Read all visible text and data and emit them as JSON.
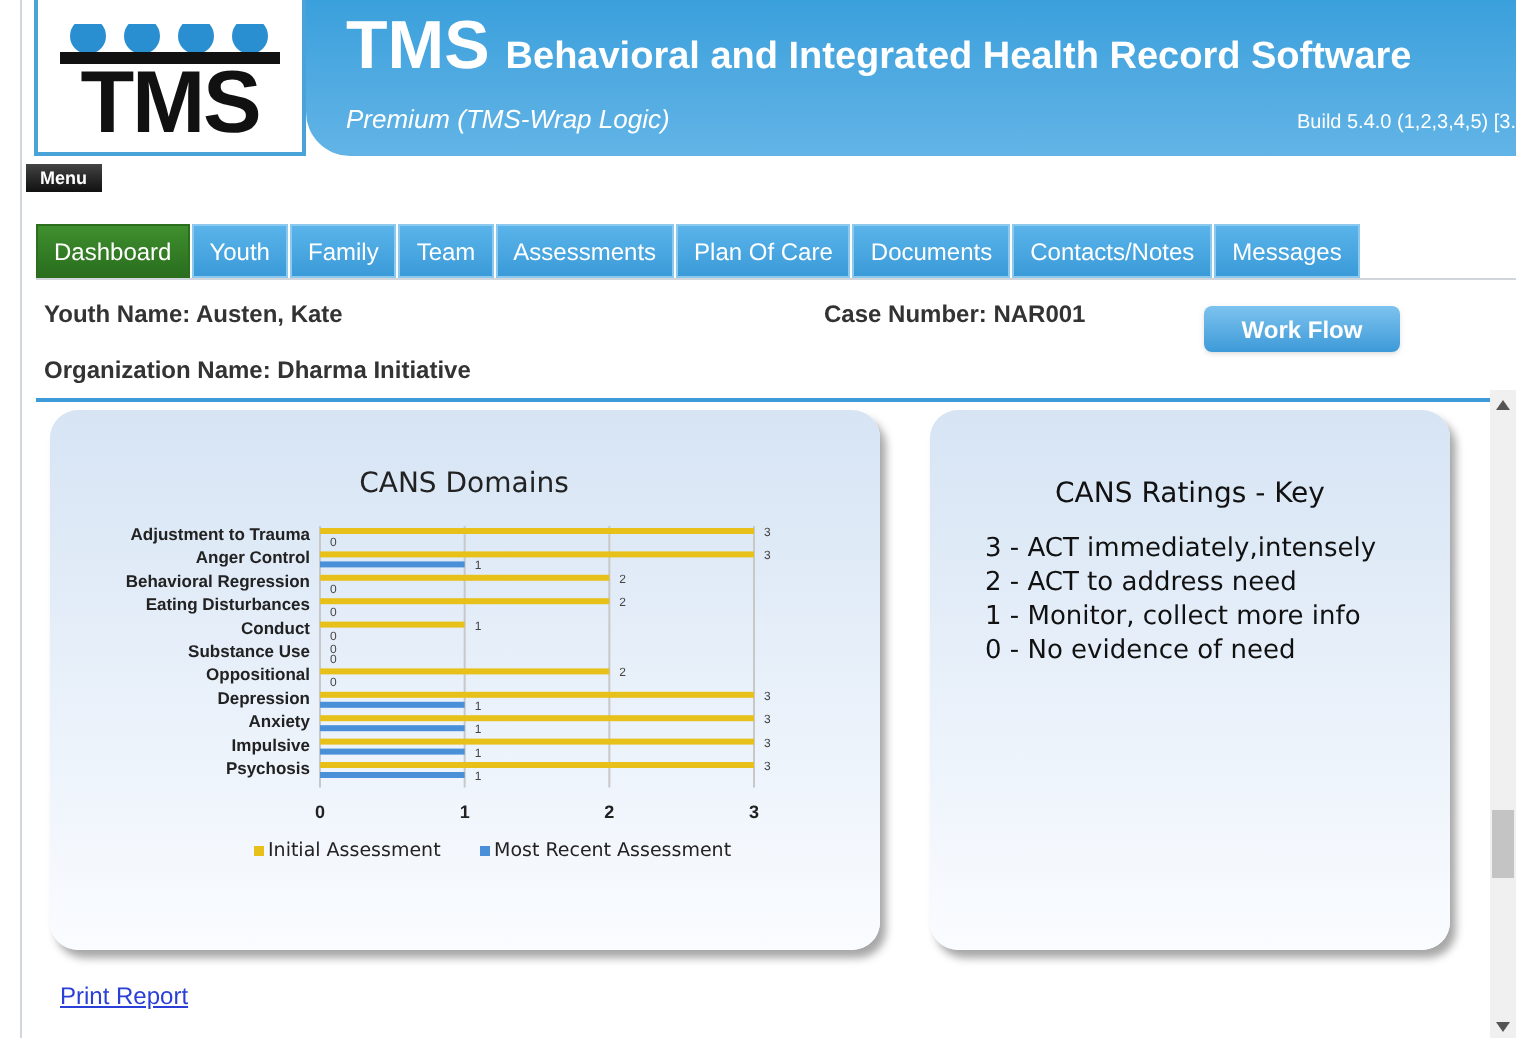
{
  "header": {
    "logo_text": "TMS",
    "app_name": "TMS",
    "app_subtitle": "Behavioral and Integrated Health Record Software",
    "edition": "Premium (TMS-Wrap Logic)",
    "build": "Build 5.4.0 (1,2,3,4,5) [3."
  },
  "menu_button": "Menu",
  "tabs": [
    {
      "label": "Dashboard",
      "selected": true
    },
    {
      "label": "Youth",
      "selected": false
    },
    {
      "label": "Family",
      "selected": false
    },
    {
      "label": "Team",
      "selected": false
    },
    {
      "label": "Assessments",
      "selected": false
    },
    {
      "label": "Plan Of Care",
      "selected": false
    },
    {
      "label": "Documents",
      "selected": false
    },
    {
      "label": "Contacts/Notes",
      "selected": false
    },
    {
      "label": "Messages",
      "selected": false
    }
  ],
  "youth_name": "Youth Name: Austen, Kate",
  "case_number": "Case Number: NAR001",
  "organization_name": "Organization Name: Dharma Initiative",
  "work_flow_button": "Work Flow",
  "domains_card": {
    "chart_data": {
      "type": "bar",
      "orientation": "horizontal",
      "title": "CANS Domains",
      "categories": [
        "Adjustment to Trauma",
        "Anger Control",
        "Behavioral Regression",
        "Eating Disturbances",
        "Conduct",
        "Substance Use",
        "Oppositional",
        "Depression",
        "Anxiety",
        "Impulsive",
        "Psychosis"
      ],
      "series": [
        {
          "name": "Initial Assessment",
          "color": "#e8c01a",
          "values": [
            3,
            3,
            2,
            2,
            1,
            0,
            2,
            3,
            3,
            3,
            3
          ]
        },
        {
          "name": "Most Recent Assessment",
          "color": "#4a90d9",
          "values": [
            0,
            1,
            0,
            0,
            0,
            0,
            0,
            1,
            1,
            1,
            1
          ]
        }
      ],
      "xlim": [
        0,
        3
      ],
      "xticks": [
        0,
        1,
        2,
        3
      ],
      "data_labels": true,
      "legend": "bottom"
    }
  },
  "key_card": {
    "title": "CANS Ratings - Key",
    "lines": [
      "3 - ACT immediately,intensely",
      "2 - ACT to address need",
      "1 - Monitor, collect more info",
      "0 - No evidence of need"
    ]
  },
  "print_report_link": "Print Report"
}
